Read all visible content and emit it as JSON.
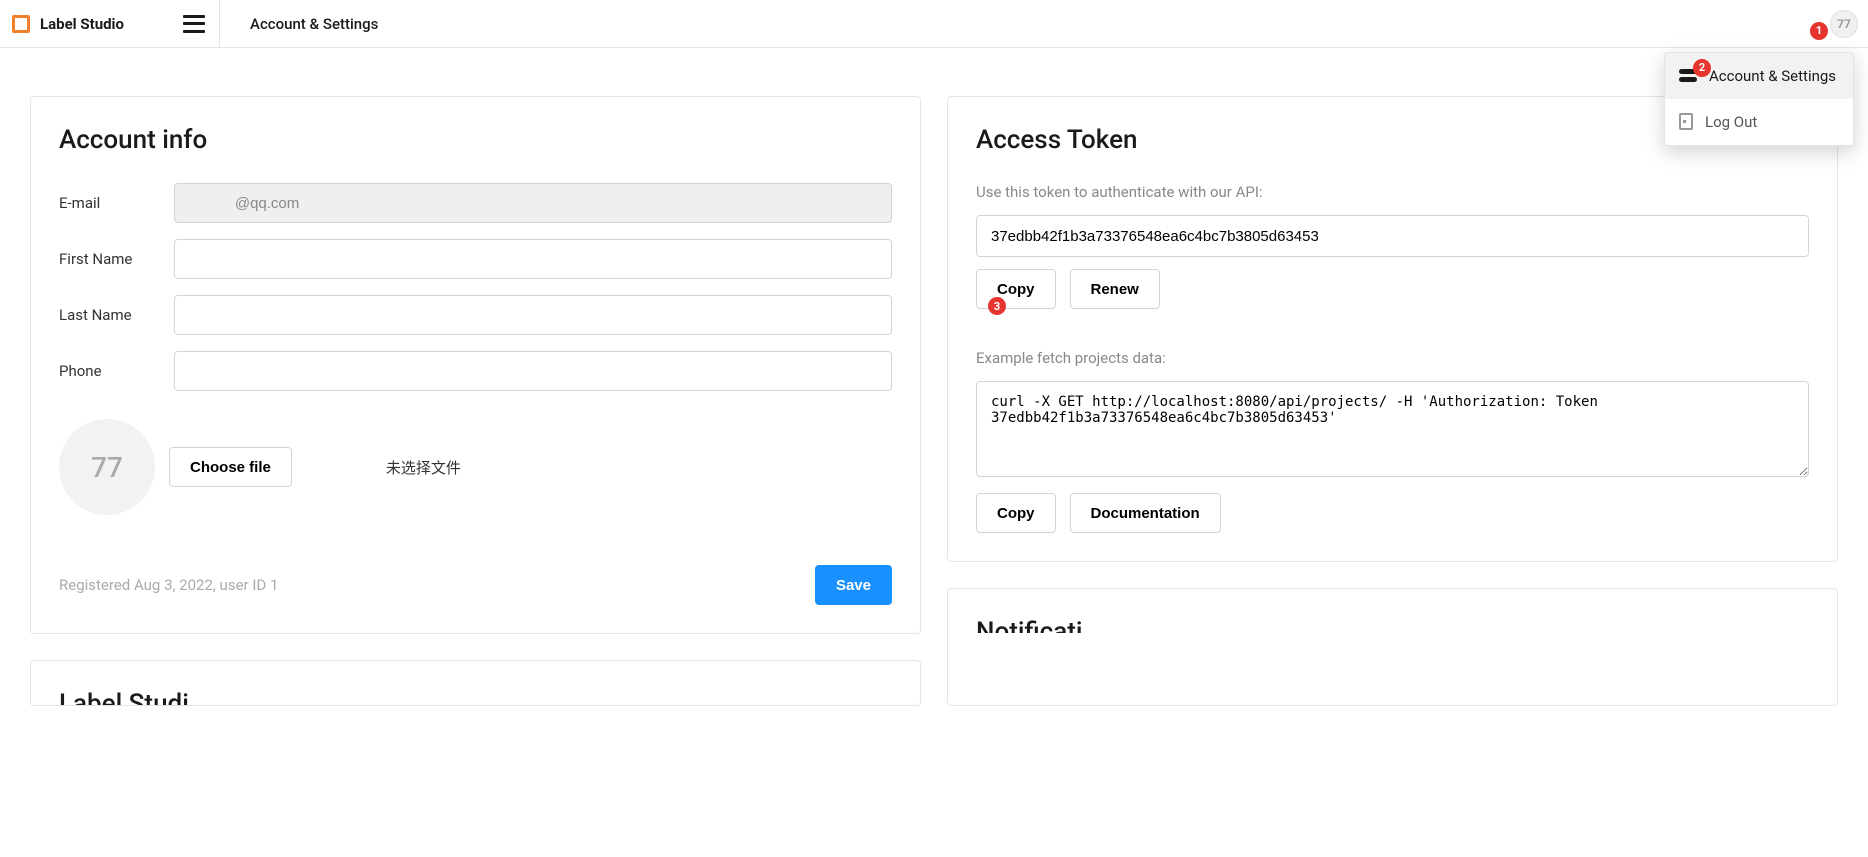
{
  "header": {
    "app_name": "Label Studio",
    "page_title": "Account & Settings",
    "avatar_initials": "77"
  },
  "dropdown": {
    "items": [
      {
        "label": "Account & Settings"
      },
      {
        "label": "Log Out"
      }
    ]
  },
  "account_info": {
    "title": "Account info",
    "labels": {
      "email": "E-mail",
      "first_name": "First Name",
      "last_name": "Last Name",
      "phone": "Phone"
    },
    "values": {
      "email": "           @qq.com",
      "first_name": "",
      "last_name": "",
      "phone": ""
    },
    "avatar_initials": "77",
    "choose_file_label": "Choose file",
    "no_file_text": "未选择文件",
    "registered_text": "Registered Aug 3, 2022, user ID 1",
    "save_label": "Save"
  },
  "access_token": {
    "title": "Access Token",
    "helper": "Use this token to authenticate with our API:",
    "token_value": "37edbb42f1b3a73376548ea6c4bc7b3805d63453",
    "copy_label": "Copy",
    "renew_label": "Renew",
    "example_label": "Example fetch projects data:",
    "curl_text": "curl -X GET http://localhost:8080/api/projects/ -H 'Authorization: Token 37edbb42f1b3a73376548ea6c4bc7b3805d63453'",
    "copy2_label": "Copy",
    "docs_label": "Documentation"
  },
  "next": {
    "left_title": "Label Studi",
    "right_title": "Notificati"
  },
  "annotations": {
    "a1": "1",
    "a2": "2",
    "a3": "3"
  }
}
